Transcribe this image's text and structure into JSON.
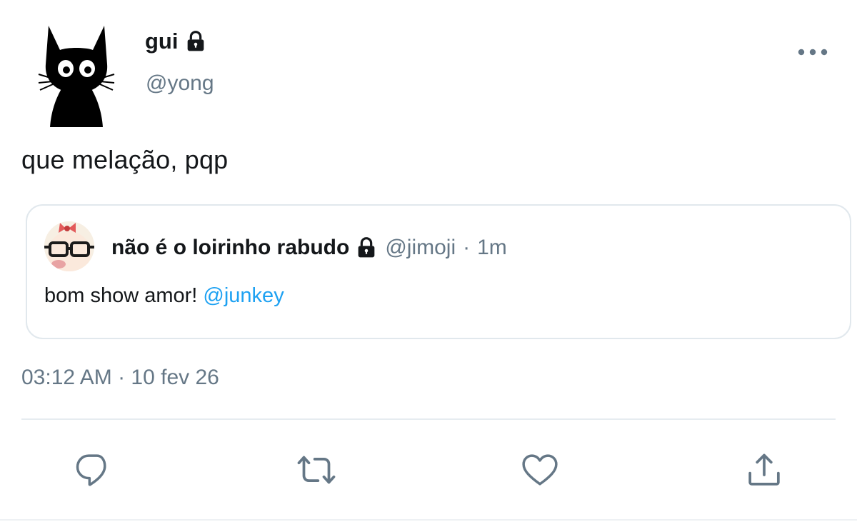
{
  "tweet": {
    "author": {
      "name": "gui",
      "handle": "@yong",
      "protected": true,
      "avatar_icon": "black-cat-icon"
    },
    "text": "que melação, pqp",
    "timestamp": "03:12 AM · 10 fev 26",
    "menu_icon": "more-options-icon"
  },
  "quote": {
    "author_name": "não é o loirinho rabudo",
    "protected": true,
    "handle": "@jimoji",
    "separator": "·",
    "time": "1m",
    "text_before": "bom show amor! ",
    "mention": "@junkey",
    "avatar_icon": "glasses-avatar-icon"
  },
  "actions": [
    {
      "name": "reply",
      "icon": "reply-icon"
    },
    {
      "name": "retweet",
      "icon": "retweet-icon"
    },
    {
      "name": "like",
      "icon": "heart-icon"
    },
    {
      "name": "share",
      "icon": "share-icon"
    }
  ],
  "colors": {
    "text": "#14171a",
    "secondary": "#657786",
    "link": "#1da1f2",
    "border": "#e1e8ed",
    "icon": "#657786"
  }
}
